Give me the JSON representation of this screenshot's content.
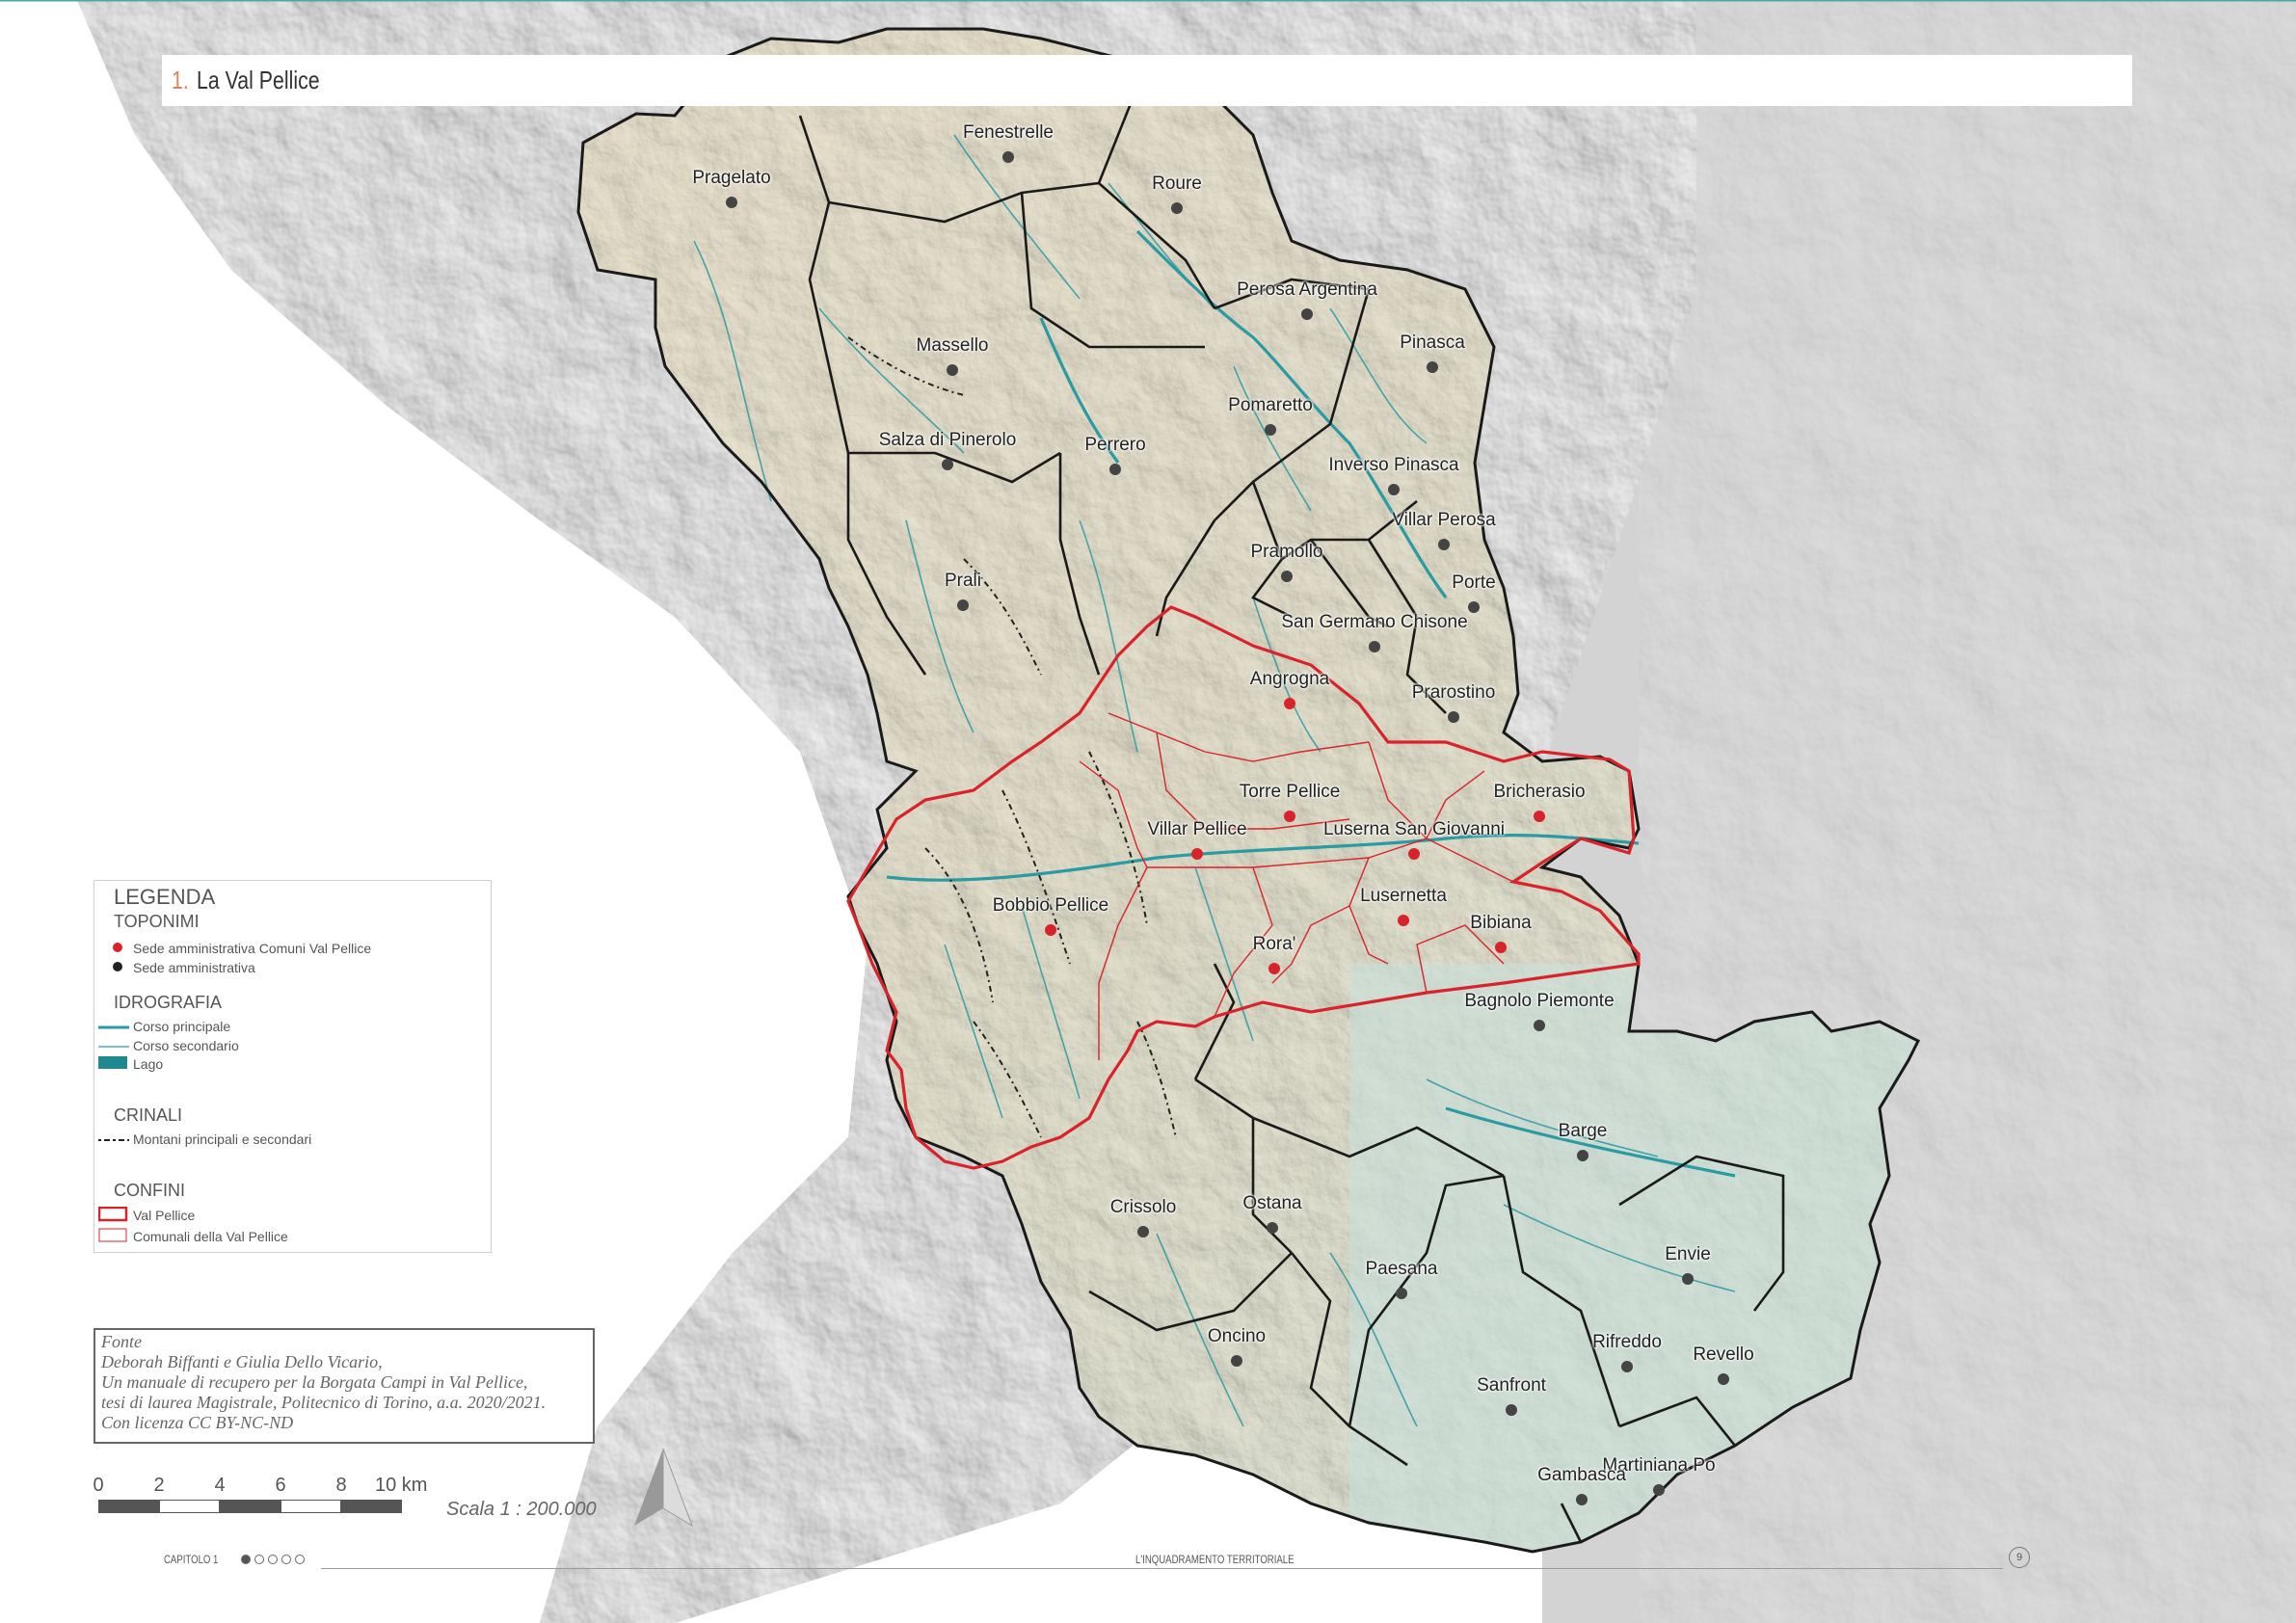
{
  "title": {
    "number": "1.",
    "text": "La Val Pellice"
  },
  "legend": {
    "heading": "LEGENDA",
    "sections": {
      "toponimi": "TOPONIMI",
      "idrografia": "IDROGRAFIA",
      "crinali": "CRINALI",
      "confini": "CONFINI"
    },
    "items": {
      "sede_val_pellice": "Sede amministrativa Comuni Val Pellice",
      "sede": "Sede amministrativa",
      "corso_principale": "Corso principale",
      "corso_secondario": "Corso secondario",
      "lago": "Lago",
      "montani": "Montani principali e secondari",
      "val_pellice": "Val Pellice",
      "comunali": "Comunali della Val Pellice"
    }
  },
  "source": {
    "lines": [
      "Fonte",
      "Deborah Biffanti e Giulia Dello Vicario,",
      "Un manuale di recupero per la Borgata Campi in Val Pellice,",
      "tesi di laurea Magistrale, Politecnico di Torino, a.a. 2020/2021.",
      "Con licenza CC BY-NC-ND"
    ]
  },
  "scale": {
    "ticks": [
      "0",
      "2",
      "4",
      "6",
      "8",
      "10 km"
    ],
    "label": "Scala 1 : 200.000"
  },
  "footer": {
    "chapter": "CAPITOLO 1",
    "section": "L'INQUADRAMENTO TERRITORIALE",
    "page": "9"
  },
  "colors": {
    "val_pellice_border": "#d8232a",
    "river": "#2a9aa3",
    "border": "#1a1a1a",
    "accent": "#d9845a"
  },
  "places": [
    {
      "name": "Fenestrelle",
      "type": "sede"
    },
    {
      "name": "Pragelato",
      "type": "sede"
    },
    {
      "name": "Roure",
      "type": "sede"
    },
    {
      "name": "Perosa Argentina",
      "type": "sede"
    },
    {
      "name": "Massello",
      "type": "sede"
    },
    {
      "name": "Pinasca",
      "type": "sede"
    },
    {
      "name": "Pomaretto",
      "type": "sede"
    },
    {
      "name": "Salza di Pinerolo",
      "type": "sede"
    },
    {
      "name": "Perrero",
      "type": "sede"
    },
    {
      "name": "Inverso Pinasca",
      "type": "sede"
    },
    {
      "name": "Villar Perosa",
      "type": "sede"
    },
    {
      "name": "Pramollo",
      "type": "sede"
    },
    {
      "name": "Prali",
      "type": "sede"
    },
    {
      "name": "Porte",
      "type": "sede"
    },
    {
      "name": "San Germano Chisone",
      "type": "sede"
    },
    {
      "name": "Angrogna",
      "type": "val_pellice"
    },
    {
      "name": "Prarostino",
      "type": "sede"
    },
    {
      "name": "Torre Pellice",
      "type": "val_pellice"
    },
    {
      "name": "Bricherasio",
      "type": "val_pellice"
    },
    {
      "name": "Villar Pellice",
      "type": "val_pellice"
    },
    {
      "name": "Luserna San Giovanni",
      "type": "val_pellice"
    },
    {
      "name": "Lusernetta",
      "type": "val_pellice"
    },
    {
      "name": "Bobbio Pellice",
      "type": "val_pellice"
    },
    {
      "name": "Bibiana",
      "type": "val_pellice"
    },
    {
      "name": "Rora'",
      "type": "val_pellice"
    },
    {
      "name": "Bagnolo Piemonte",
      "type": "sede"
    },
    {
      "name": "Barge",
      "type": "sede"
    },
    {
      "name": "Crissolo",
      "type": "sede"
    },
    {
      "name": "Ostana",
      "type": "sede"
    },
    {
      "name": "Envie",
      "type": "sede"
    },
    {
      "name": "Paesana",
      "type": "sede"
    },
    {
      "name": "Oncino",
      "type": "sede"
    },
    {
      "name": "Rifreddo",
      "type": "sede"
    },
    {
      "name": "Revello",
      "type": "sede"
    },
    {
      "name": "Sanfront",
      "type": "sede"
    },
    {
      "name": "Martiniana Po",
      "type": "sede"
    },
    {
      "name": "Gambasca",
      "type": "sede"
    }
  ]
}
